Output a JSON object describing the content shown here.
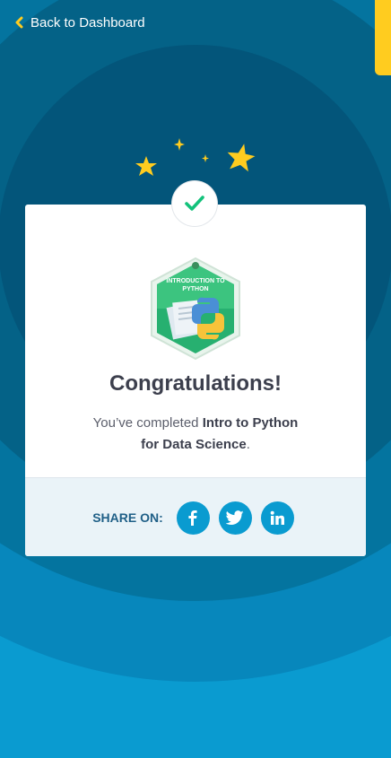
{
  "nav": {
    "back_label": "Back to Dashboard"
  },
  "badge": {
    "line1": "INTRODUCTION TO",
    "line2": "PYTHON"
  },
  "card": {
    "title": "Congratulations!",
    "desc_prefix": "You’ve completed ",
    "course_line1": "Intro to Python",
    "course_line2": "for Data Science",
    "desc_suffix": "."
  },
  "share": {
    "label": "SHARE ON:",
    "networks": [
      "facebook",
      "twitter",
      "linkedin"
    ]
  },
  "colors": {
    "accent": "#0a9bd0",
    "yellow": "#ffcc1f",
    "check_green": "#13c27b"
  }
}
